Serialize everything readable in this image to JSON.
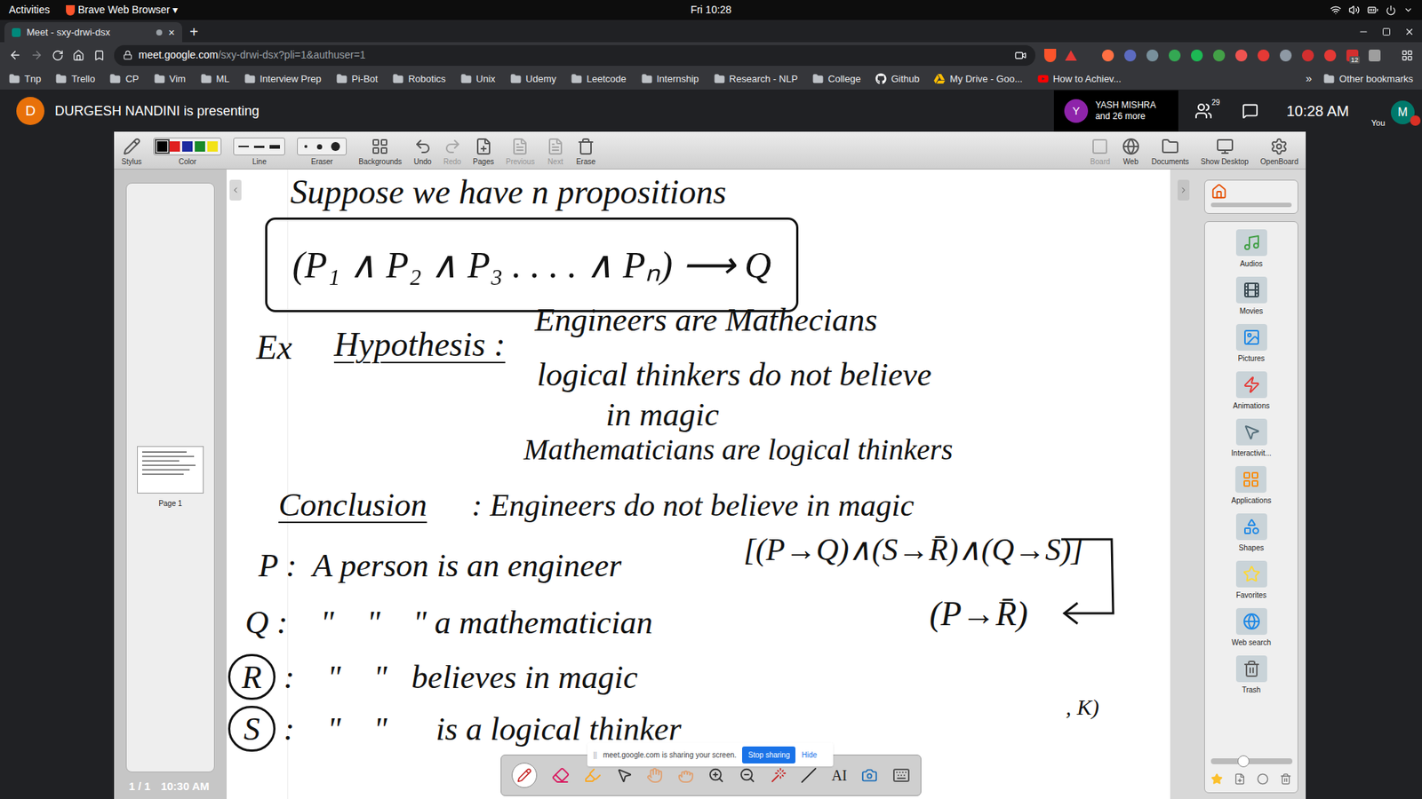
{
  "system_bar": {
    "activities": "Activities",
    "app": "Brave Web Browser",
    "app_arrow": "▾",
    "clock": "Fri 10:28"
  },
  "browser": {
    "tab": {
      "title": "Meet - sxy-drwi-dsx",
      "selected": true,
      "close": "×"
    },
    "new_tab": "+",
    "url": {
      "host": "meet.google.com",
      "path": "/sxy-drwi-dsx?pli=1&authuser=1"
    },
    "extension_badge": "12",
    "bookmarks": [
      {
        "label": "Tnp",
        "kind": "folder"
      },
      {
        "label": "Trello",
        "kind": "folder"
      },
      {
        "label": "CP",
        "kind": "folder"
      },
      {
        "label": "Vim",
        "kind": "folder"
      },
      {
        "label": "ML",
        "kind": "folder"
      },
      {
        "label": "Interview Prep",
        "kind": "folder"
      },
      {
        "label": "Pi-Bot",
        "kind": "folder"
      },
      {
        "label": "Robotics",
        "kind": "folder"
      },
      {
        "label": "Unix",
        "kind": "folder"
      },
      {
        "label": "Udemy",
        "kind": "folder"
      },
      {
        "label": "Leetcode",
        "kind": "folder"
      },
      {
        "label": "Internship",
        "kind": "folder"
      },
      {
        "label": "Research - NLP",
        "kind": "folder"
      },
      {
        "label": "College",
        "kind": "folder"
      },
      {
        "label": "Github",
        "kind": "github"
      },
      {
        "label": "My Drive - Goo...",
        "kind": "drive"
      },
      {
        "label": "How to Achiev...",
        "kind": "youtube"
      }
    ],
    "bookmarks_overflow": "»",
    "other_bookmarks": "Other bookmarks"
  },
  "meet": {
    "presenter_initial": "D",
    "presenting": "DURGESH NANDINI is presenting",
    "participant_initial": "Y",
    "participant_name": "YASH MISHRA",
    "others": "and 26 more",
    "people_count": "29",
    "time": "10:28 AM",
    "you_label": "You",
    "you_initial": "M"
  },
  "openboard": {
    "tools": [
      {
        "label": "Stylus",
        "kind": "stylus",
        "disabled": false
      },
      {
        "label": "Color",
        "kind": "colors",
        "disabled": false
      },
      {
        "label": "Line",
        "kind": "lines",
        "disabled": false
      },
      {
        "label": "Eraser",
        "kind": "erasers",
        "disabled": false
      },
      {
        "label": "Backgrounds",
        "kind": "backgrounds",
        "disabled": false
      },
      {
        "label": "Undo",
        "kind": "undo",
        "disabled": false
      },
      {
        "label": "Redo",
        "kind": "redo",
        "disabled": true
      },
      {
        "label": "Pages",
        "kind": "pages",
        "disabled": false
      },
      {
        "label": "Previous",
        "kind": "previous",
        "disabled": true
      },
      {
        "label": "Next",
        "kind": "next",
        "disabled": true
      },
      {
        "label": "Erase",
        "kind": "erase",
        "disabled": false
      }
    ],
    "colors": [
      {
        "color": "#000000",
        "selected": true
      },
      {
        "color": "#e02020",
        "selected": false
      },
      {
        "color": "#1c2aa0",
        "selected": false
      },
      {
        "color": "#1a8a2a",
        "selected": false
      },
      {
        "color": "#f2e218",
        "selected": false
      }
    ],
    "right_tools": [
      {
        "label": "Board",
        "kind": "board",
        "disabled": true
      },
      {
        "label": "Web",
        "kind": "web",
        "disabled": false
      },
      {
        "label": "Documents",
        "kind": "documents",
        "disabled": false
      },
      {
        "label": "Show Desktop",
        "kind": "desktop",
        "disabled": false
      },
      {
        "label": "OpenBoard",
        "kind": "settings",
        "disabled": false
      }
    ],
    "page": {
      "label": "Page 1",
      "counter": "1 / 1",
      "time": "10:30 AM",
      "selected": true
    },
    "library": [
      {
        "label": "Audios",
        "kind": "audio"
      },
      {
        "label": "Movies",
        "kind": "movie"
      },
      {
        "label": "Pictures",
        "kind": "picture"
      },
      {
        "label": "Animations",
        "kind": "animation"
      },
      {
        "label": "Interactivit...",
        "kind": "interactive"
      },
      {
        "label": "Applications",
        "kind": "application"
      },
      {
        "label": "Shapes",
        "kind": "shape"
      },
      {
        "label": "Favorites",
        "kind": "favorite"
      },
      {
        "label": "Web search",
        "kind": "websearch"
      },
      {
        "label": "Trash",
        "kind": "trash"
      }
    ],
    "board": [
      {
        "kind": "text",
        "text": "Suppose we have n propositions"
      },
      {
        "kind": "boxed",
        "text": "(P₁ ∧ P₂ ∧ P₃ . . . . ∧ Pₙ) ⟶ Q"
      },
      {
        "kind": "text",
        "text": "Ex"
      },
      {
        "kind": "underlined",
        "text": "Hypothesis :"
      },
      {
        "kind": "text",
        "text": "Engineers are Mathecians"
      },
      {
        "kind": "text",
        "text": "logical thinkers do not believe"
      },
      {
        "kind": "text",
        "text": "in magic"
      },
      {
        "kind": "text",
        "text": "Mathematicians are logical thinkers"
      },
      {
        "kind": "underlined",
        "text": "Conclusion"
      },
      {
        "kind": "text",
        "text": ": Engineers do not believe in magic"
      },
      {
        "kind": "text",
        "text": "P :  A person is an engineer"
      },
      {
        "kind": "text",
        "text": "Q :    \"    \"    \" a mathematician"
      },
      {
        "kind": "circled",
        "letter": "R",
        "text": " :    \"    \"   believes in magic"
      },
      {
        "kind": "circled",
        "letter": "S",
        "text": " :    \"    \"      is a logical thinker"
      },
      {
        "kind": "text",
        "text": "[(P→Q)∧(S→R̄)∧(Q→S)]"
      },
      {
        "kind": "text",
        "text": "(P→R̄)"
      },
      {
        "kind": "text",
        "text": ", K)"
      }
    ],
    "floating_text_tool": "AI"
  },
  "share_notice": {
    "handle": "||",
    "message": "meet.google.com is sharing your screen.",
    "stop": "Stop sharing",
    "hide": "Hide"
  }
}
